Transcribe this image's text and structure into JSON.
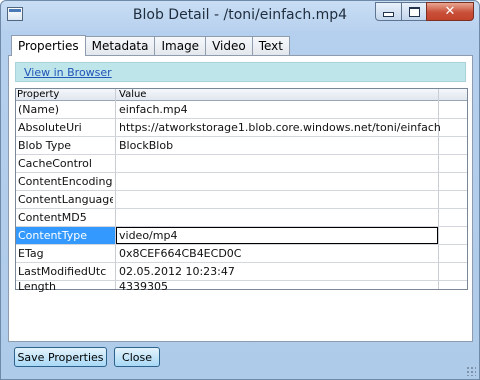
{
  "window": {
    "title": "Blob Detail - /toni/einfach.mp4",
    "close_glyph": "✕"
  },
  "tabs": [
    {
      "label": "Properties",
      "active": true
    },
    {
      "label": "Metadata",
      "active": false
    },
    {
      "label": "Image",
      "active": false
    },
    {
      "label": "Video",
      "active": false
    },
    {
      "label": "Text",
      "active": false
    }
  ],
  "link": {
    "label": "View in Browser"
  },
  "grid": {
    "headers": {
      "property": "Property",
      "value": "Value"
    },
    "rows": [
      {
        "property": "(Name)",
        "value": "einfach.mp4"
      },
      {
        "property": "AbsoluteUri",
        "value": "https://atworkstorage1.blob.core.windows.net/toni/einfach.mp4"
      },
      {
        "property": "Blob Type",
        "value": "BlockBlob"
      },
      {
        "property": "CacheControl",
        "value": ""
      },
      {
        "property": "ContentEncoding",
        "value": ""
      },
      {
        "property": "ContentLanguage",
        "value": ""
      },
      {
        "property": "ContentMD5",
        "value": ""
      },
      {
        "property": "ContentType",
        "value": "video/mp4",
        "selected": true
      },
      {
        "property": "ETag",
        "value": "0x8CEF664CB4ECD0C"
      },
      {
        "property": "LastModifiedUtc",
        "value": "02.05.2012 10:23:47"
      },
      {
        "property": "Length",
        "value": "4339305"
      }
    ]
  },
  "buttons": {
    "save": "Save Properties",
    "close": "Close"
  },
  "colors": {
    "selection": "#3399ff",
    "link_bar": "#bde5ea",
    "close_button": "#c9503a"
  }
}
